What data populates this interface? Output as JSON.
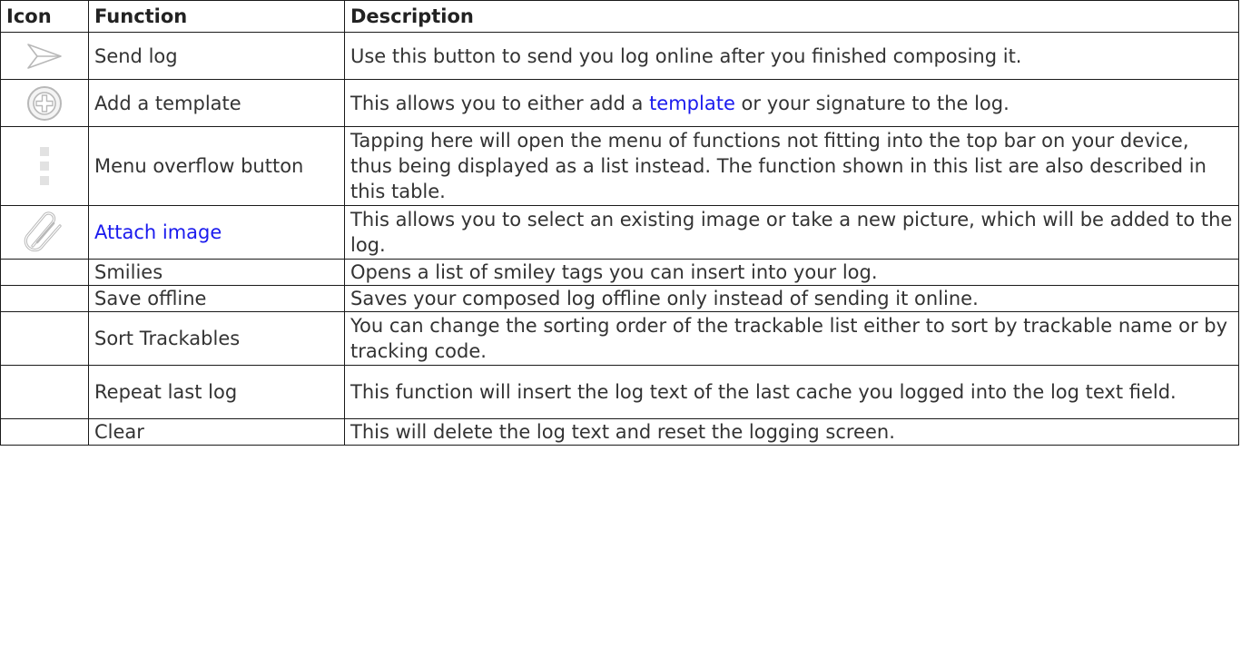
{
  "table": {
    "headers": {
      "icon": "Icon",
      "function": "Function",
      "description": "Description"
    },
    "rows": [
      {
        "icon": "send-icon",
        "function": "Send log",
        "description": "Use this button to send you log online after you finished composing it."
      },
      {
        "icon": "add-circle-icon",
        "function": "Add a template",
        "description_before": "This allows you to either add a ",
        "description_link": "template",
        "description_after": " or your signature to the log."
      },
      {
        "icon": "menu-overflow-icon",
        "function": "Menu overflow button",
        "description": "Tapping here will open the menu of functions not fitting into the top bar on your device, thus being displayed as a list instead. The function shown in this list are also described in this table."
      },
      {
        "icon": "paperclip-icon",
        "function": "Attach image",
        "description": "This allows you to select an existing image or take a new picture, which will be added to the log."
      },
      {
        "icon": "",
        "function": "Smilies",
        "description": "Opens a list of smiley tags you can insert into your log."
      },
      {
        "icon": "",
        "function": "Save offline",
        "description": "Saves your composed log offline only instead of sending it online."
      },
      {
        "icon": "",
        "function": "Sort Trackables",
        "description": "You can change the sorting order of the trackable list either to sort by trackable name or by tracking code."
      },
      {
        "icon": "",
        "function": "Repeat last log",
        "description": "This function will insert the log text of the last cache you logged into the log text field."
      },
      {
        "icon": "",
        "function": "Clear",
        "description": "This will delete the log text and reset the logging screen."
      }
    ]
  },
  "colors": {
    "link": "#1a1aee",
    "text": "#333333",
    "border": "#1a1a1a",
    "icon": "#b8b8b8"
  }
}
